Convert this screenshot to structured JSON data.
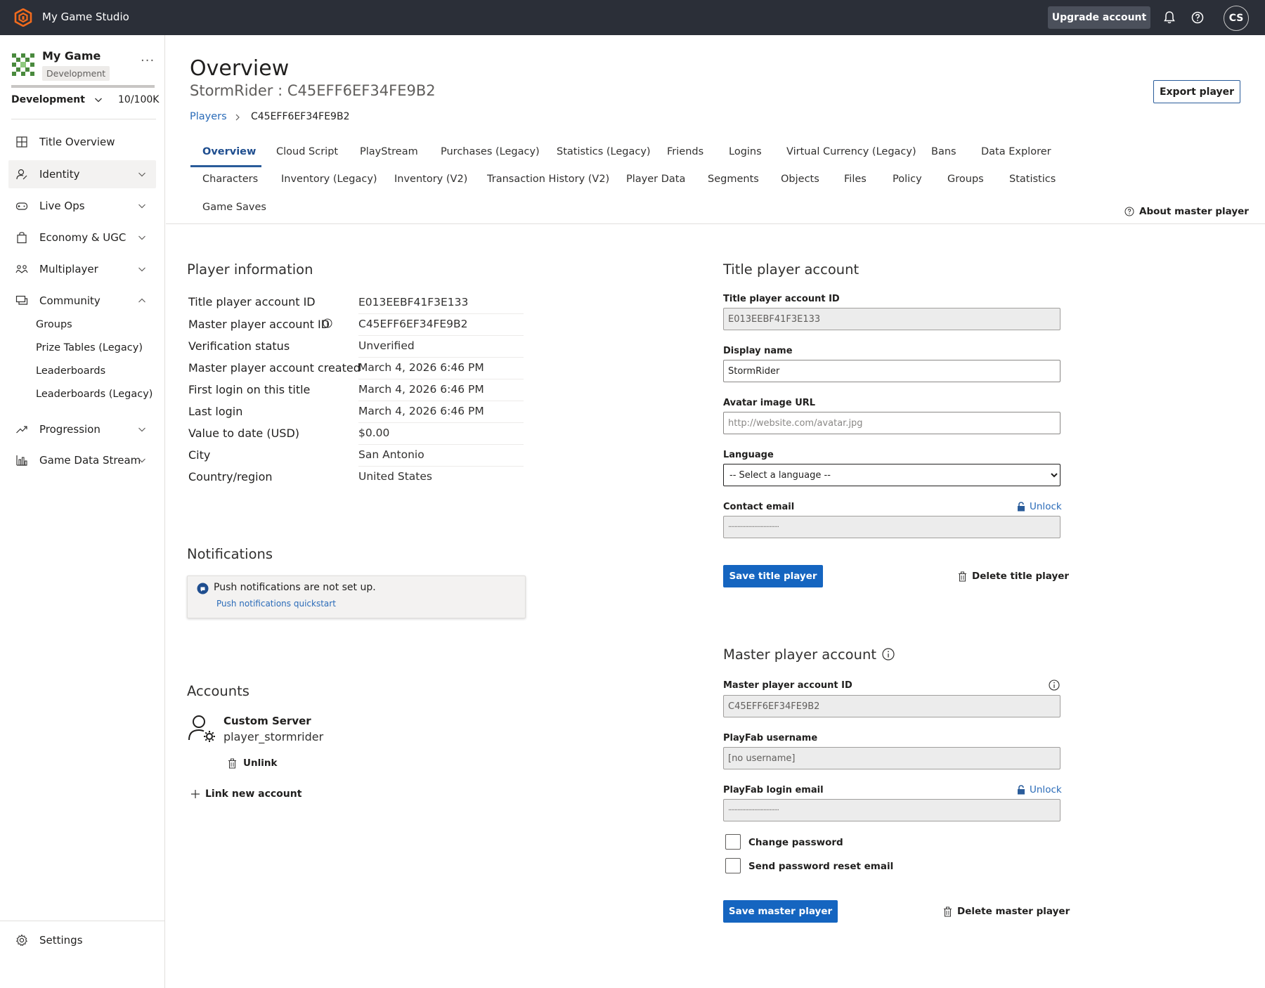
{
  "header": {
    "app_title": "My Game Studio",
    "upgrade_label": "Upgrade account",
    "avatar_initials": "CS",
    "icons": [
      "logo-icon",
      "bell-icon",
      "help-icon"
    ],
    "colors": {
      "bar": "#2b2f38",
      "brand": "#f26b1d",
      "accent": "#2a5c9a"
    }
  },
  "sidebar": {
    "game_name": "My Game",
    "env_badge": "Development",
    "env_select": "Development",
    "usage_count": "10/100K",
    "usage_fraction": 0.1,
    "nav": [
      {
        "label": "Title Overview",
        "icon": "grid-icon"
      },
      {
        "label": "Identity",
        "icon": "identity-icon"
      },
      {
        "label": "Live Ops",
        "icon": "gamepad-icon"
      },
      {
        "label": "Economy & UGC",
        "icon": "bag-icon"
      },
      {
        "label": "Multiplayer",
        "icon": "people-icon"
      },
      {
        "label": "Community",
        "icon": "chat-icon"
      },
      {
        "label": "Progression",
        "icon": "trend-icon"
      },
      {
        "label": "Game Data Stream",
        "icon": "bars-icon"
      }
    ],
    "community_sub": [
      "Groups",
      "Prize Tables (Legacy)",
      "Leaderboards",
      "Leaderboards (Legacy)"
    ],
    "settings_label": "Settings"
  },
  "page": {
    "title": "Overview",
    "player_subtitle": "StormRider : C45EFF6EF34FE9B2",
    "export_label": "Export player",
    "breadcrumb": {
      "parent": "Players",
      "current": "C45EFF6EF34FE9B2"
    },
    "tabs_row1": [
      "Overview",
      "Cloud Script",
      "PlayStream",
      "Purchases (Legacy)",
      "Statistics (Legacy)",
      "Friends",
      "Logins",
      "Virtual Currency (Legacy)",
      "Bans",
      "Data Explorer"
    ],
    "tabs_row2": [
      "Characters",
      "Inventory (Legacy)",
      "Inventory (V2)",
      "Transaction History (V2)",
      "Player Data",
      "Segments",
      "Objects",
      "Files",
      "Policy",
      "Groups",
      "Statistics"
    ],
    "tabs_row3": [
      "Game Saves"
    ],
    "about_label": "About master player"
  },
  "player_info": {
    "title": "Player information",
    "rows": [
      {
        "label": "Title player account ID",
        "value": "E013EEBF41F3E133"
      },
      {
        "label": "Master player account ID",
        "value": "C45EFF6EF34FE9B2"
      },
      {
        "label": "Verification status",
        "value": "Unverified"
      },
      {
        "label": "Master player account created",
        "value": "March 4, 2026 6:46 PM"
      },
      {
        "label": "First login on this title",
        "value": "March 4, 2026 6:46 PM"
      },
      {
        "label": "Last login",
        "value": "March 4, 2026 6:46 PM"
      },
      {
        "label": "Value to date (USD)",
        "value": "$0.00"
      },
      {
        "label": "City",
        "value": "San Antonio"
      },
      {
        "label": "Country/region",
        "value": "United States"
      }
    ]
  },
  "notifications": {
    "title": "Notifications",
    "message": "Push notifications are not set up.",
    "link": "Push notifications quickstart"
  },
  "accounts": {
    "title": "Accounts",
    "items": [
      {
        "type": "Custom Server",
        "username": "player_stormrider",
        "unlink_label": "Unlink"
      }
    ],
    "link_new_label": "Link new account"
  },
  "title_player": {
    "title": "Title player account",
    "id_label": "Title player account ID",
    "id_value": "E013EEBF41F3E133",
    "display_name_label": "Display name",
    "display_name_value": "StormRider",
    "avatar_label": "Avatar image URL",
    "avatar_placeholder": "http://website.com/avatar.jpg",
    "language_label": "Language",
    "language_selected": "-- Select a language --",
    "contact_email_label": "Contact email",
    "contact_email_value": "·································",
    "unlock_label": "Unlock",
    "save_label": "Save title player",
    "delete_label": "Delete title player"
  },
  "master_player": {
    "title": "Master player account",
    "id_label": "Master player account ID",
    "id_value": "C45EFF6EF34FE9B2",
    "username_label": "PlayFab username",
    "username_value": "[no username]",
    "login_email_label": "PlayFab login email",
    "login_email_value": "·································",
    "unlock_label": "Unlock",
    "change_password_label": "Change password",
    "send_reset_label": "Send password reset email",
    "save_label": "Save master player",
    "delete_label": "Delete master player"
  }
}
